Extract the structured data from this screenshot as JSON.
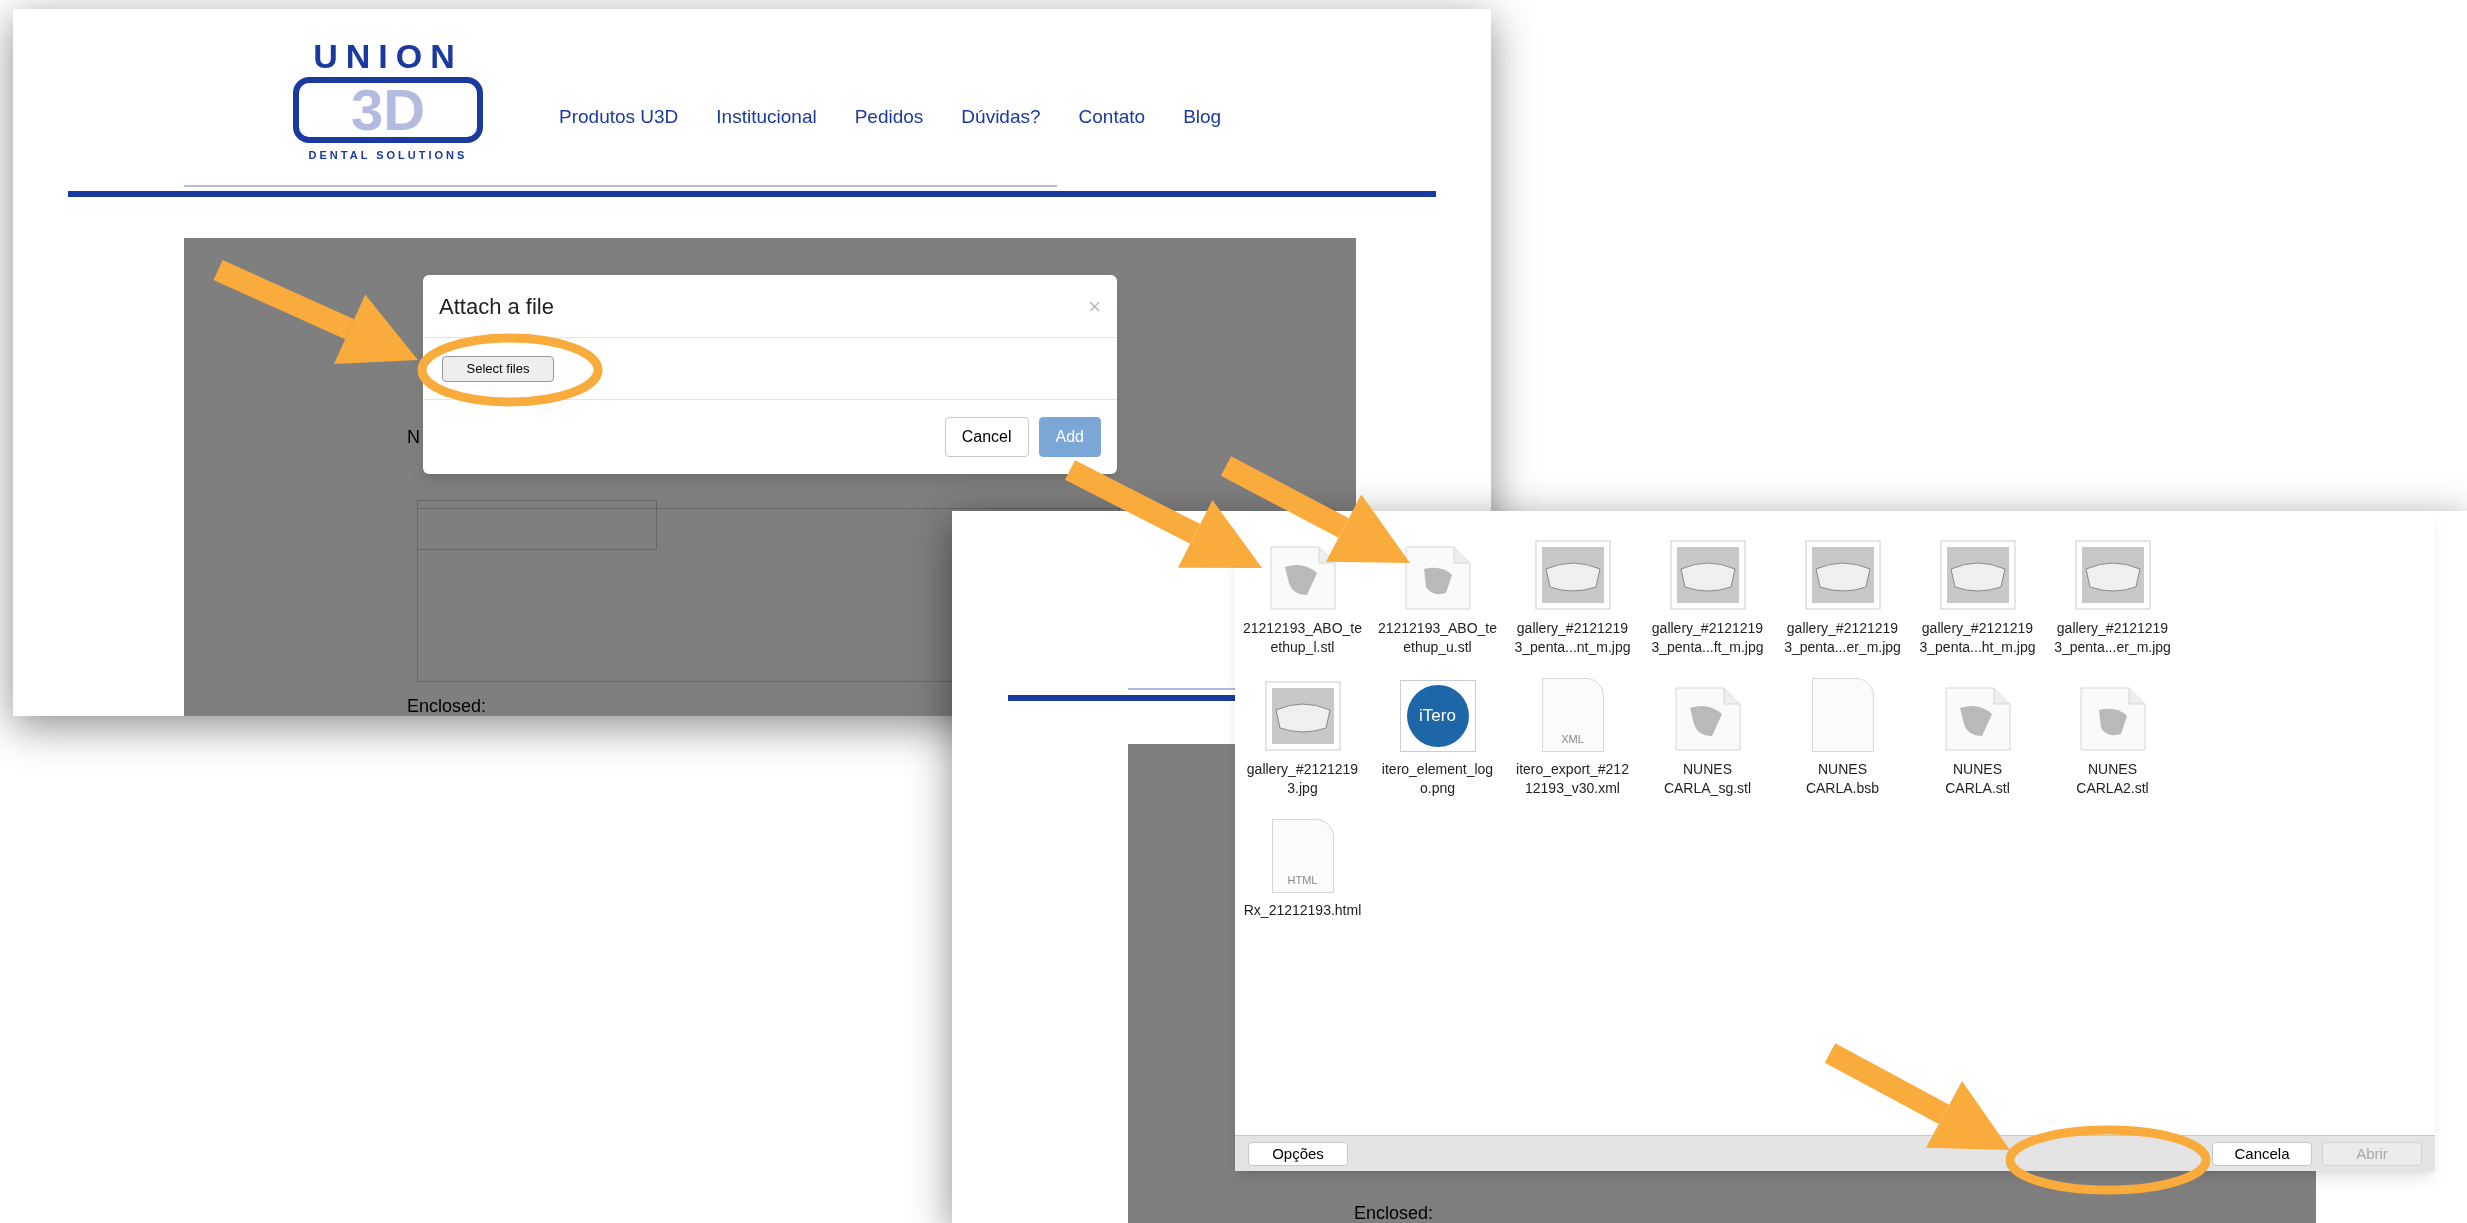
{
  "left_screenshot": {
    "logo": {
      "top": "UNION",
      "mark": "3D",
      "bottom": "DENTAL SOLUTIONS"
    },
    "nav": [
      {
        "label": "Produtos U3D"
      },
      {
        "label": "Institucional"
      },
      {
        "label": "Pedidos"
      },
      {
        "label": "Dúvidas?"
      },
      {
        "label": "Contato"
      },
      {
        "label": "Blog"
      }
    ],
    "partial_label": "N",
    "enclosed_label": "Enclosed:",
    "dialog": {
      "title": "Attach a file",
      "close": "×",
      "select_button": "Select files",
      "buttons": [
        {
          "label": "Cancel",
          "kind": "default"
        },
        {
          "label": "Add",
          "kind": "primary"
        }
      ]
    }
  },
  "right_screenshot": {
    "enclosed_label": "Enclosed:",
    "file_dialog": {
      "files": [
        {
          "kind": "model",
          "name_lines": [
            "21212193_ABO_te",
            "ethup_l.stl"
          ]
        },
        {
          "kind": "model",
          "name_lines": [
            "21212193_ABO_te",
            "ethup_u.stl"
          ]
        },
        {
          "kind": "photo",
          "name_lines": [
            "gallery_#2121219",
            "3_penta...nt_m.jpg"
          ]
        },
        {
          "kind": "photo",
          "name_lines": [
            "gallery_#2121219",
            "3_penta...ft_m.jpg"
          ]
        },
        {
          "kind": "photo",
          "name_lines": [
            "gallery_#2121219",
            "3_penta...er_m.jpg"
          ]
        },
        {
          "kind": "photo",
          "name_lines": [
            "gallery_#2121219",
            "3_penta...ht_m.jpg"
          ]
        },
        {
          "kind": "photo",
          "name_lines": [
            "gallery_#2121219",
            "3_penta...er_m.jpg"
          ]
        },
        {
          "kind": "photo",
          "name_lines": [
            "gallery_#2121219",
            "3.jpg"
          ]
        },
        {
          "kind": "logo",
          "logo_text": "iTero",
          "name_lines": [
            "itero_element_log",
            "o.png"
          ]
        },
        {
          "kind": "document",
          "badge": "XML",
          "name_lines": [
            "itero_export_#212",
            "12193_v30.xml"
          ]
        },
        {
          "kind": "model",
          "name_lines": [
            "NUNES",
            "CARLA_sg.stl"
          ]
        },
        {
          "kind": "document",
          "name_lines": [
            "NUNES",
            "CARLA.bsb"
          ]
        },
        {
          "kind": "model",
          "name_lines": [
            "NUNES",
            "CARLA.stl"
          ]
        },
        {
          "kind": "model",
          "name_lines": [
            "NUNES",
            "CARLA2.stl"
          ]
        },
        {
          "kind": "document",
          "badge": "HTML",
          "name_lines": [
            "Rx_21212193.html"
          ]
        }
      ],
      "buttons": [
        {
          "label": "Opções",
          "kind": "default"
        },
        {
          "label": "Cancela",
          "kind": "default"
        },
        {
          "label": "Abrir",
          "kind": "disabled"
        }
      ]
    }
  }
}
